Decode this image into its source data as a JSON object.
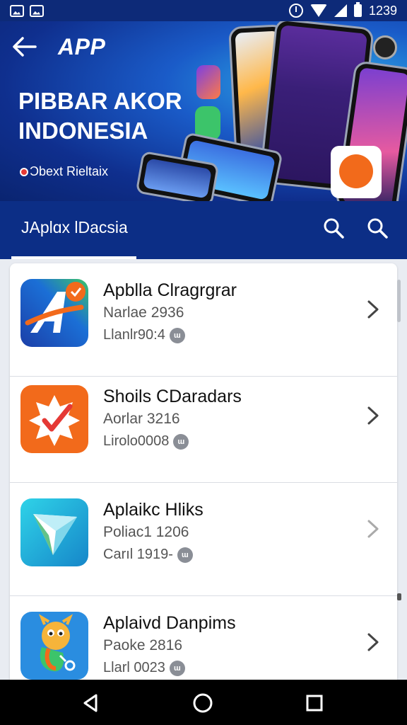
{
  "status_bar": {
    "time": "1239"
  },
  "header": {
    "title": "APP",
    "hero_title": "PIBBAR AKOR INDONESIA",
    "hero_subtitle": "Ɔbext Rieltaix"
  },
  "tabs": {
    "active_label": "JAplɑx lDacsia"
  },
  "apps": [
    {
      "name": "Apblla Clragrgrar",
      "subtitle": "Narlae 2936",
      "meta": "Llanlr90:4",
      "badge": "ɯ",
      "icon": "stylized-a-icon",
      "color": "#1b6fd6"
    },
    {
      "name": "Shoils CDaradars",
      "subtitle": "Aorlar 3216",
      "meta": "Lirolo0008",
      "badge": "ɯ",
      "icon": "check-burst-icon",
      "color": "#f26a1b"
    },
    {
      "name": "Aplaikc Hliks",
      "subtitle": "Poliac1 1206",
      "meta": "Carıl 1919-",
      "badge": "ɯ",
      "icon": "paper-plane-icon",
      "color": "#19b6d9"
    },
    {
      "name": "Aplaivd Danpims",
      "subtitle": "Paoke 2816",
      "meta": "Llarl 0023",
      "badge": "ɯ",
      "icon": "bird-mascot-icon",
      "color": "#2a8de0"
    }
  ]
}
